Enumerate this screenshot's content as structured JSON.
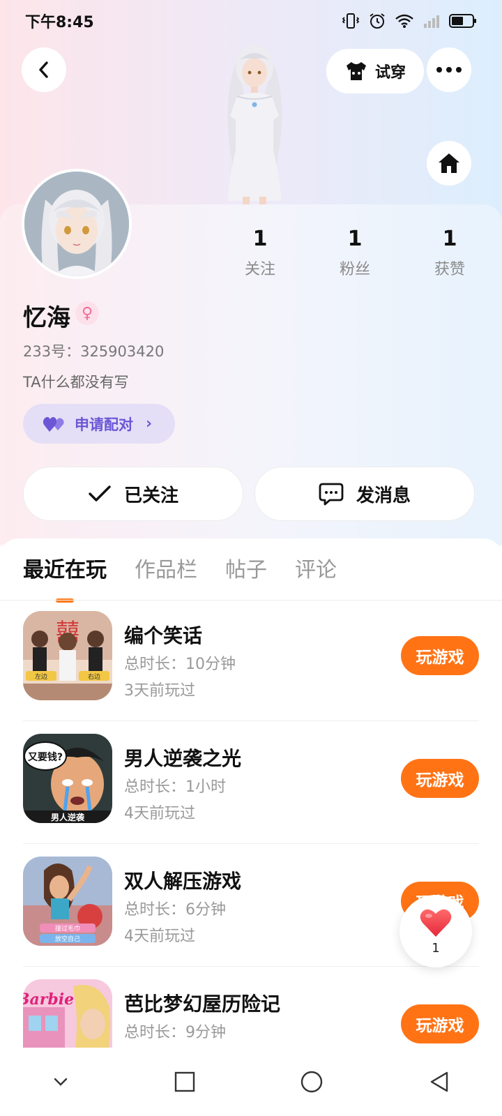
{
  "status": {
    "time": "下午8:45"
  },
  "header": {
    "tryon_label": "试穿"
  },
  "profile": {
    "username": "忆海",
    "gender_symbol": "♀",
    "user_id": "233号：325903420",
    "bio": "TA什么都没有写",
    "pair_label": "申请配对",
    "stats": [
      {
        "value": "1",
        "label": "关注"
      },
      {
        "value": "1",
        "label": "粉丝"
      },
      {
        "value": "1",
        "label": "获赞"
      }
    ],
    "follow_label": "已关注",
    "message_label": "发消息"
  },
  "tabs": [
    "最近在玩",
    "作品栏",
    "帖子",
    "评论"
  ],
  "games": [
    {
      "title": "编个笑话",
      "duration": "总时长：10分钟",
      "last_played": "3天前玩过",
      "play_label": "玩游戏"
    },
    {
      "title": "男人逆袭之光",
      "duration": "总时长：1小时",
      "last_played": "4天前玩过",
      "play_label": "玩游戏"
    },
    {
      "title": "双人解压游戏",
      "duration": "总时长：6分钟",
      "last_played": "4天前玩过",
      "play_label": "玩游戏"
    },
    {
      "title": "芭比梦幻屋历险记",
      "duration": "总时长：9分钟",
      "last_played": "",
      "play_label": "玩游戏"
    }
  ],
  "game_icon_text": {
    "g1_left": "左边",
    "g1_right": "右边",
    "g2_bubble": "又要钱?",
    "g2_caption": "男人逆袭",
    "g3_line1": "接过毛巾",
    "g3_line2": "放空自己",
    "g4_brand": "Barbie"
  },
  "like_float": {
    "count": "1"
  },
  "colors": {
    "accent": "#ff7315",
    "pair_purple": "#6b56d6",
    "pair_bg": "#e4dff6"
  },
  "icons": {
    "back": "chevron-left-icon",
    "tryon": "tshirt-icon",
    "more": "more-dots-icon",
    "home": "home-icon",
    "pair": "double-heart-icon",
    "follow": "checkmark-icon",
    "message": "chat-bubble-icon",
    "like": "heart-icon"
  }
}
